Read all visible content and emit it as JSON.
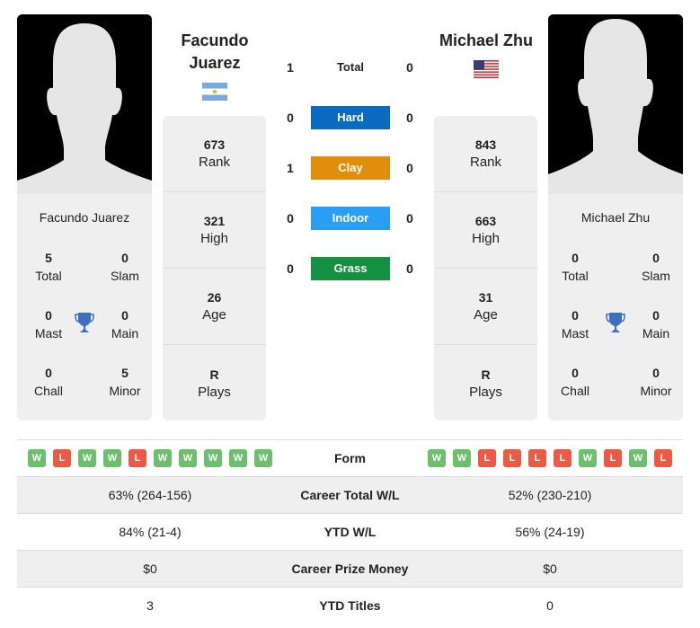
{
  "colors": {
    "hard": "#0a6bc1",
    "clay": "#e08e0b",
    "indoor": "#2b9ef3",
    "grass": "#149041",
    "win": "#6cbf6c",
    "loss": "#ec5a45",
    "trophy": "#3b6fbf"
  },
  "player1": {
    "name_line1": "Facundo",
    "name_line2": "Juarez",
    "full_name": "Facundo Juarez",
    "flag": "argentina-flag",
    "titles": {
      "total": "5",
      "total_label": "Total",
      "slam": "0",
      "slam_label": "Slam",
      "mast": "0",
      "mast_label": "Mast",
      "main": "0",
      "main_label": "Main",
      "chall": "0",
      "chall_label": "Chall",
      "minor": "5",
      "minor_label": "Minor"
    },
    "rank": "673",
    "rank_label": "Rank",
    "high": "321",
    "high_label": "High",
    "age": "26",
    "age_label": "Age",
    "plays": "R",
    "plays_label": "Plays",
    "form": [
      "W",
      "L",
      "W",
      "W",
      "L",
      "W",
      "W",
      "W",
      "W",
      "W"
    ]
  },
  "player2": {
    "name": "Michael Zhu",
    "full_name": "Michael Zhu",
    "flag": "usa-flag",
    "titles": {
      "total": "0",
      "total_label": "Total",
      "slam": "0",
      "slam_label": "Slam",
      "mast": "0",
      "mast_label": "Mast",
      "main": "0",
      "main_label": "Main",
      "chall": "0",
      "chall_label": "Chall",
      "minor": "0",
      "minor_label": "Minor"
    },
    "rank": "843",
    "rank_label": "Rank",
    "high": "663",
    "high_label": "High",
    "age": "31",
    "age_label": "Age",
    "plays": "R",
    "plays_label": "Plays",
    "form": [
      "W",
      "W",
      "L",
      "L",
      "L",
      "L",
      "W",
      "L",
      "W",
      "L"
    ]
  },
  "h2h": [
    {
      "label": "Total",
      "p1": "1",
      "p2": "0"
    },
    {
      "label": "Hard",
      "p1": "0",
      "p2": "0"
    },
    {
      "label": "Clay",
      "p1": "1",
      "p2": "0"
    },
    {
      "label": "Indoor",
      "p1": "0",
      "p2": "0"
    },
    {
      "label": "Grass",
      "p1": "0",
      "p2": "0"
    }
  ],
  "stats": {
    "form_label": "Form",
    "rows": [
      {
        "label": "Career Total W/L",
        "p1": "63% (264-156)",
        "p2": "52% (230-210)"
      },
      {
        "label": "YTD W/L",
        "p1": "84% (21-4)",
        "p2": "56% (24-19)"
      },
      {
        "label": "Career Prize Money",
        "p1": "$0",
        "p2": "$0"
      },
      {
        "label": "YTD Titles",
        "p1": "3",
        "p2": "0"
      }
    ]
  }
}
